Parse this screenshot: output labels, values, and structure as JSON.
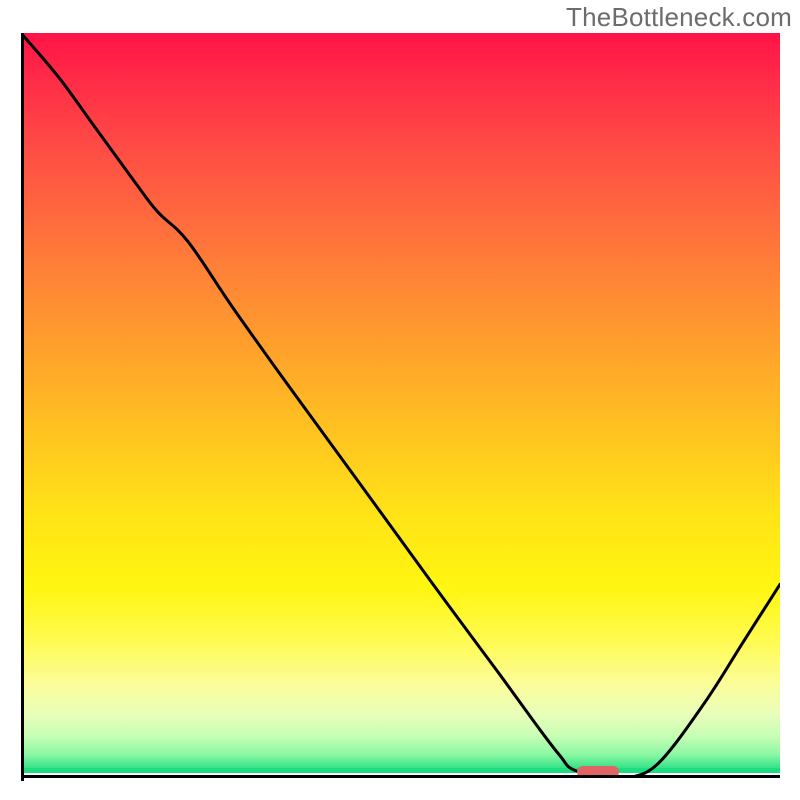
{
  "watermark": "TheBottleneck.com",
  "chart_data": {
    "type": "line",
    "title": "",
    "xlabel": "",
    "ylabel": "",
    "xlim": [
      0,
      100
    ],
    "ylim": [
      0,
      100
    ],
    "x": [
      0,
      5,
      10,
      15,
      18,
      22,
      28,
      35,
      45,
      55,
      63,
      68,
      71,
      73,
      78,
      80,
      84,
      90,
      95,
      100
    ],
    "values": [
      100,
      94,
      87,
      80,
      76,
      72,
      63,
      53,
      39,
      25,
      14,
      7,
      3,
      1,
      0,
      0,
      2,
      10,
      18,
      26
    ],
    "marker": {
      "x": 76,
      "y": 0.8,
      "w": 5.5,
      "h": 1.6
    },
    "colors": {
      "curve": "#000000",
      "marker": "#e16464",
      "gradient_top": "#ff1347",
      "gradient_bottom": "#1ddd80"
    }
  }
}
